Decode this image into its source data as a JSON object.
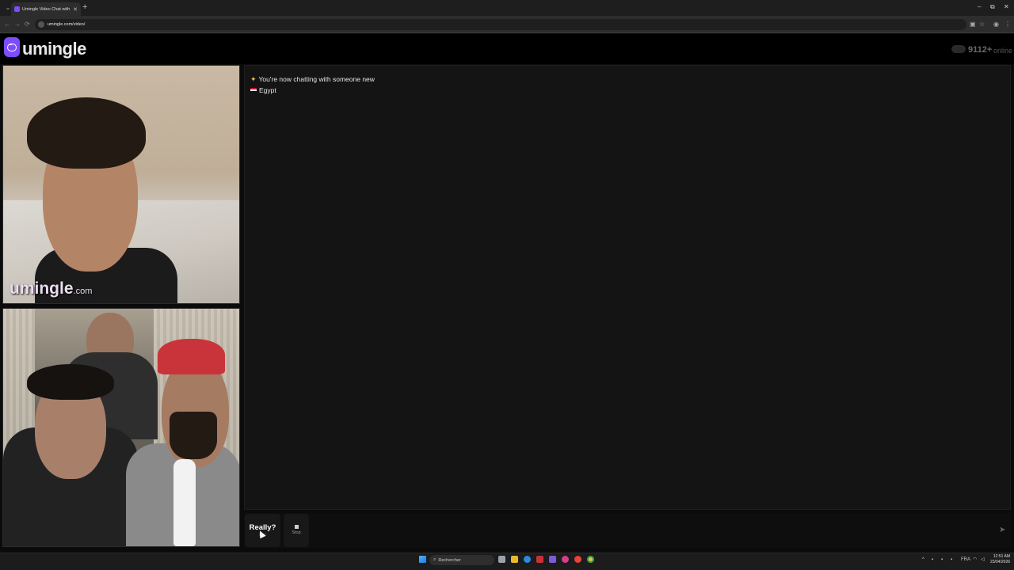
{
  "browser": {
    "tab_title": "Umingle Video Chat with S...",
    "tab_close": "✕",
    "new_tab": "+",
    "url": "umingle.com/video/",
    "nav_back": "←",
    "nav_forward": "→",
    "nav_reload": "⟳",
    "window_minimize": "–",
    "window_restore": "⧉",
    "window_close": "✕"
  },
  "site": {
    "logo_text": "umingle",
    "online_count": "9112+",
    "online_label": "online"
  },
  "video": {
    "watermark_main": "umingle",
    "watermark_suffix": ".com"
  },
  "chat": {
    "messages": [
      {
        "icon": "sparkle-icon",
        "text": "You're now chatting with someone new"
      },
      {
        "icon": "egypt-flag-icon",
        "text": "Egypt"
      }
    ],
    "input_placeholder": ""
  },
  "controls": {
    "next_label": "Really?",
    "next_sub": "Esc",
    "stop_label": "Stop",
    "send_icon": "send-icon"
  },
  "taskbar": {
    "search_placeholder": "Rechercher",
    "lang": "FRA",
    "time": "12:51 AM",
    "date": "23/04/2026"
  },
  "colors": {
    "brand": "#7c4dff",
    "chat_bg": "#141414",
    "page_bg": "#0b0b0b",
    "header_bg": "#000000"
  }
}
